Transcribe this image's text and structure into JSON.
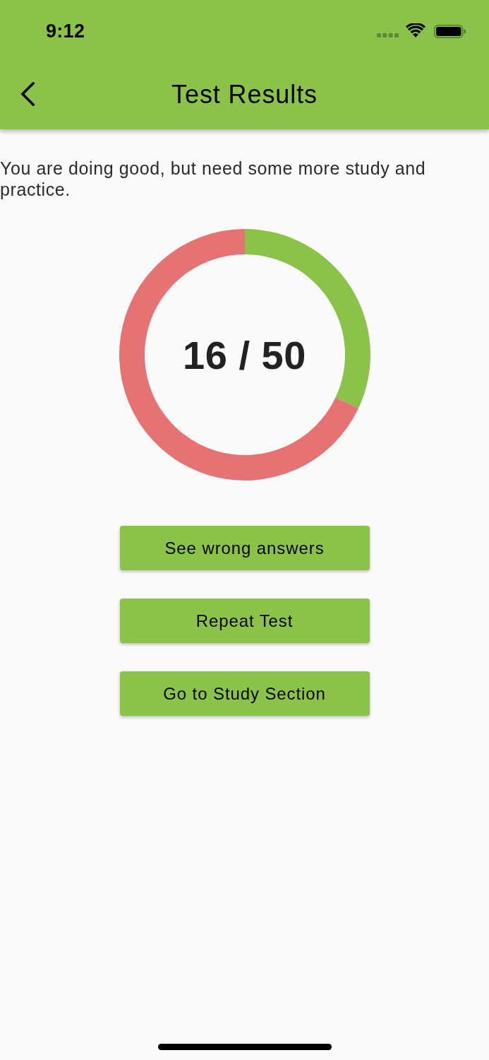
{
  "status_bar": {
    "time": "9:12"
  },
  "app_bar": {
    "title": "Test Results"
  },
  "message": "You are doing good, but need some more study and practice.",
  "score": {
    "text": "16 / 50",
    "chart_data": {
      "type": "donut",
      "values": [
        32,
        68
      ]
    }
  },
  "buttons": [
    "See wrong answers",
    "Repeat Test",
    "Go to Study Section"
  ]
}
